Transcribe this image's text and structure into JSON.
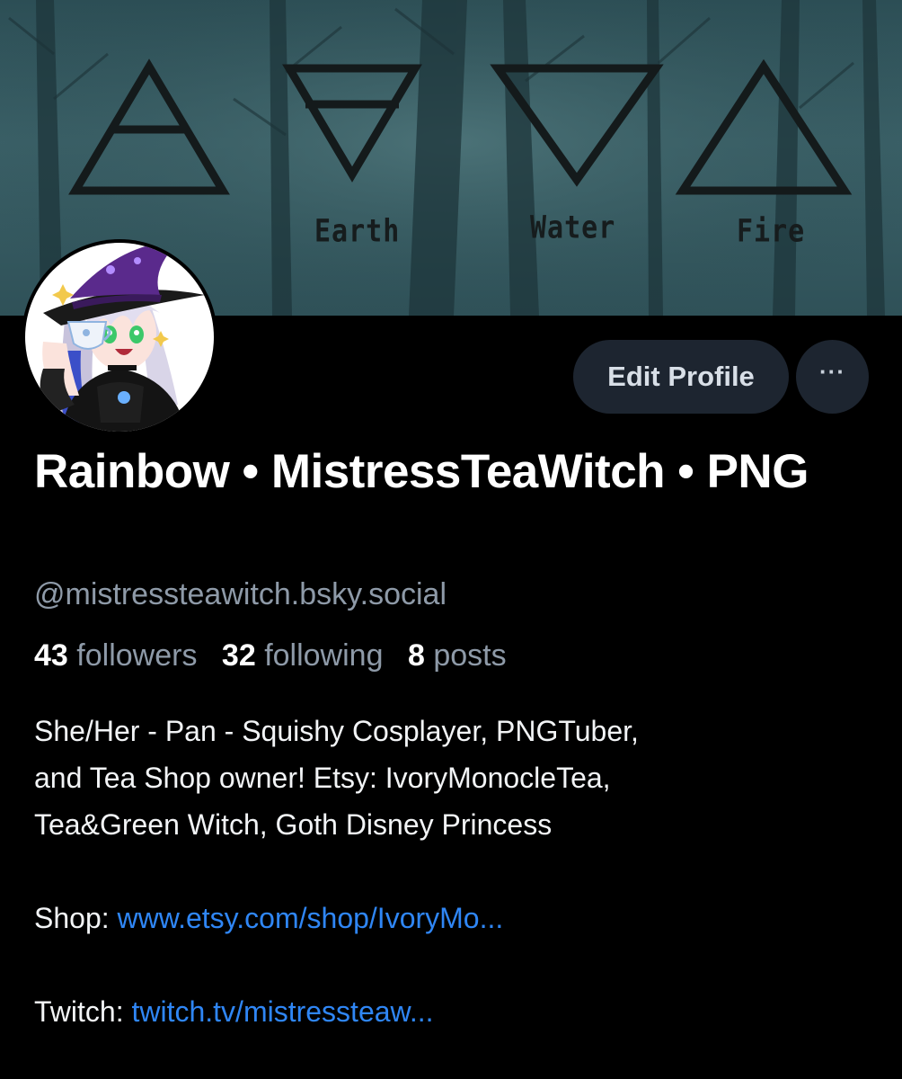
{
  "banner": {
    "elements": [
      "Air",
      "Earth",
      "Water",
      "Fire"
    ],
    "shown_labels": [
      "Earth",
      "Water",
      "Fire"
    ]
  },
  "profile": {
    "display_name": "Rainbow • MistressTeaWitch • PNG",
    "handle": "@mistressteawitch.bsky.social",
    "stats": {
      "followers_count": "43",
      "followers_label": "followers",
      "following_count": "32",
      "following_label": "following",
      "posts_count": "8",
      "posts_label": "posts"
    },
    "bio": {
      "line1": "She/Her - Pan - Squishy Cosplayer, PNGTuber,",
      "line2": "and Tea Shop owner! Etsy: IvoryMonocleTea,",
      "line3": "Tea&Green Witch, Goth Disney Princess",
      "shop_label": "Shop: ",
      "shop_link": "www.etsy.com/shop/IvoryMo...",
      "twitch_label": "Twitch: ",
      "twitch_link": "twitch.tv/mistressteaw..."
    }
  },
  "actions": {
    "edit_profile": "Edit Profile",
    "more": "···"
  },
  "colors": {
    "background": "#000000",
    "button_bg": "#1d2530",
    "link": "#2f86f5",
    "muted": "#8e9aa8",
    "banner_teal": "#3b6168"
  },
  "icons": {
    "more": "ellipsis-icon",
    "avatar": "witch-avatar"
  }
}
